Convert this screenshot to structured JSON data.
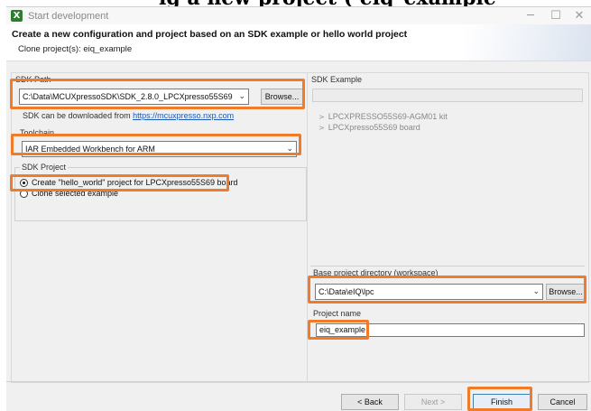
{
  "window": {
    "title": "Start development",
    "minimize": "─",
    "maximize": "☐",
    "close": "✕"
  },
  "header": {
    "title": "Create a new configuration and project based on an SDK example or hello world project",
    "subtitle": "Clone project(s): eiq_example"
  },
  "sdk_path": {
    "label": "SDK Path",
    "value": "C:\\Data\\MCUXpressoSDK\\SDK_2.8.0_LPCXpresso55S69",
    "browse": "Browse...",
    "download_text": "SDK can be downloaded from ",
    "download_link": "https://mcuxpresso.nxp.com"
  },
  "toolchain": {
    "label": "Toolchain",
    "value": "IAR Embedded Workbench for ARM"
  },
  "sdk_project": {
    "label": "SDK Project",
    "option_hello": "Create \"hello_world\" project for LPCXpresso55S69 board",
    "option_clone": "Clone selected example"
  },
  "sdk_example": {
    "label": "SDK Example",
    "tree": [
      {
        "label": "LPCXPRESSO55S69-AGM01 kit"
      },
      {
        "label": "LPCXpresso55S69 board"
      }
    ]
  },
  "workspace": {
    "label": "Base project directory (workspace)",
    "value": "C:\\Data\\eIQ\\lpc",
    "browse": "Browse..."
  },
  "project_name": {
    "label": "Project name",
    "value": "eiq_example"
  },
  "buttons": {
    "back": "< Back",
    "next": "Next >",
    "finish": "Finish",
    "cancel": "Cancel"
  },
  "colors": {
    "highlight": "#f07c2a",
    "link": "#1a56b8"
  }
}
